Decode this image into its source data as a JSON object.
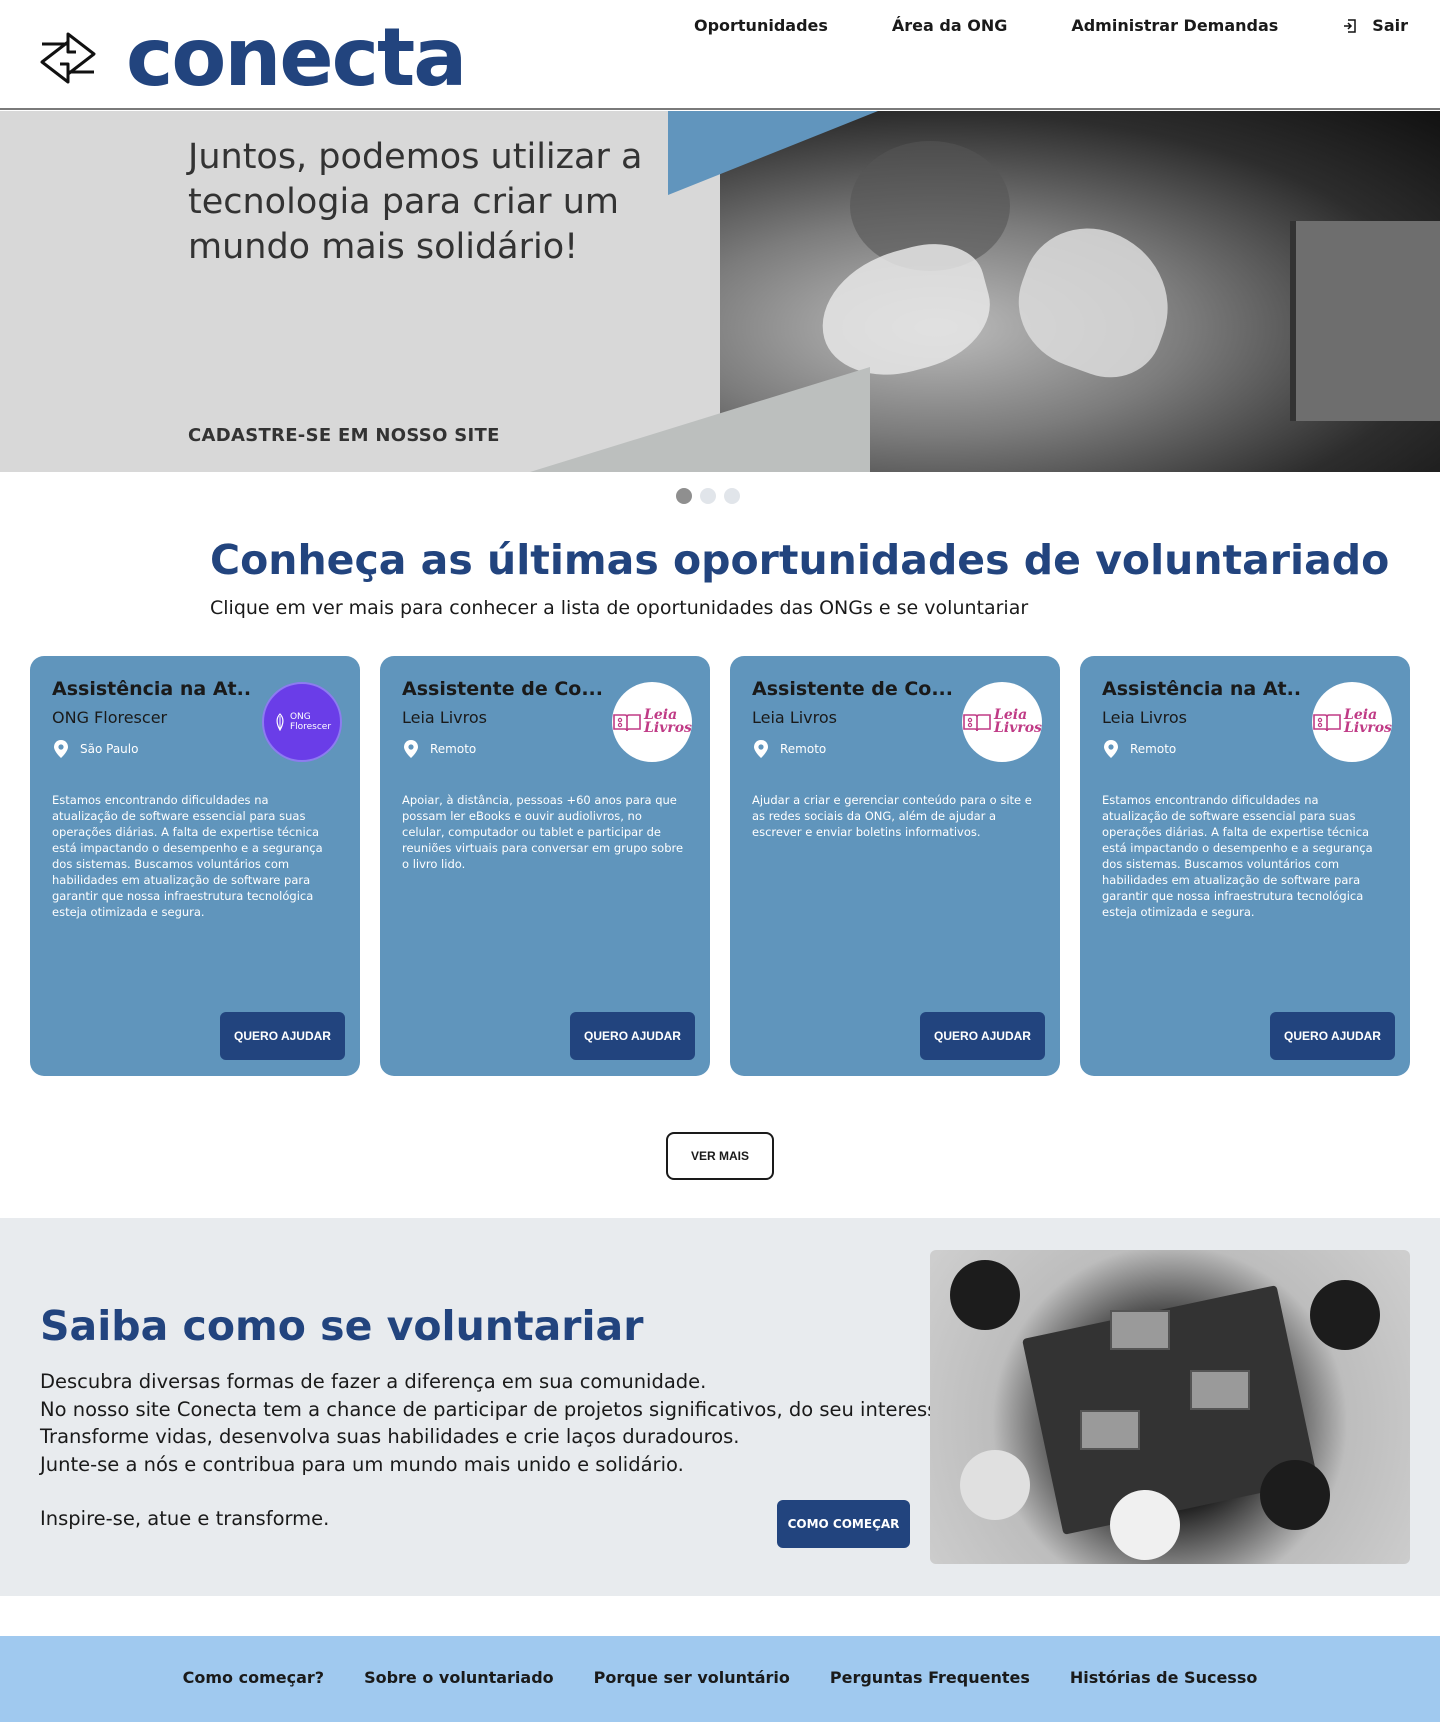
{
  "brand": {
    "name": "conecta",
    "color": "#22447e"
  },
  "nav": {
    "items": [
      "Oportunidades",
      "Área da ONG",
      "Administrar Demandas"
    ],
    "logout_label": "Sair",
    "logout_icon": "logout-icon"
  },
  "hero": {
    "title": "Juntos, podemos utilizar a tecnologia para criar um mundo mais solidário!",
    "cta": "CADASTRE-SE EM NOSSO SITE",
    "slides": 3,
    "active_slide": 1
  },
  "opportunities": {
    "title": "Conheça as últimas oportunidades de voluntariado",
    "subtitle": "Clique em ver mais para conhecer a lista de oportunidades das ONGs e se voluntariar",
    "button_label": "QUERO AJUDAR",
    "cards": [
      {
        "title": "Assistência na At...",
        "org": "ONG Florescer",
        "location": "São Paulo",
        "logo_line1": "ONG",
        "logo_line2": "Florescer",
        "description": "Estamos encontrando dificuldades na atualização de software essencial para suas operações diárias. A falta de expertise técnica está impactando o desempenho e a segurança dos sistemas. Buscamos voluntários com habilidades em atualização de software para garantir que nossa infraestrutura tecnológica esteja otimizada e segura."
      },
      {
        "title": "Assistente de Co...",
        "org": "Leia Livros",
        "location": "Remoto",
        "logo_line1": "Leia",
        "logo_line2": "Livros",
        "description": "Apoiar, à distância, pessoas +60 anos para que possam ler eBooks e ouvir audiolivros, no celular, computador ou tablet e participar de reuniões virtuais para conversar em grupo sobre o livro lido."
      },
      {
        "title": "Assistente de Co...",
        "org": "Leia Livros",
        "location": "Remoto",
        "logo_line1": "Leia",
        "logo_line2": "Livros",
        "description": "Ajudar a criar e gerenciar conteúdo para o site e as redes sociais da ONG, além de ajudar a escrever e enviar boletins informativos."
      },
      {
        "title": "Assistência na At...",
        "org": "Leia Livros",
        "location": "Remoto",
        "logo_line1": "Leia",
        "logo_line2": "Livros",
        "description": "Estamos encontrando dificuldades na atualização de software essencial para suas operações diárias. A falta de expertise técnica está impactando o desempenho e a segurança dos sistemas. Buscamos voluntários com habilidades em atualização de software para garantir que nossa infraestrutura tecnológica esteja otimizada e segura."
      }
    ],
    "see_more_label": "VER MAIS"
  },
  "saiba": {
    "title": "Saiba como se voluntariar",
    "lines": [
      "Descubra diversas formas de fazer a diferença em sua comunidade.",
      "No nosso site Conecta tem a chance de participar de projetos significativos, do seu interesse.",
      "Transforme vidas, desenvolva suas habilidades e crie laços duradouros.",
      "Junte-se a nós e contribua para um mundo mais unido e solidário."
    ],
    "closing": "Inspire-se, atue e transforme.",
    "button_label": "COMO COMEÇAR"
  },
  "footer": {
    "links": [
      "Como começar?",
      "Sobre o voluntariado",
      "Porque ser voluntário",
      "Perguntas Frequentes",
      "Histórias de Sucesso"
    ]
  },
  "colors": {
    "card_bg": "#6095bc",
    "button_bg": "#22447e",
    "footer_bg": "#a0c9ef",
    "section_bg": "#e8ebee",
    "leia_pink": "#c03b86",
    "florescer_purple": "#6a3de8"
  }
}
